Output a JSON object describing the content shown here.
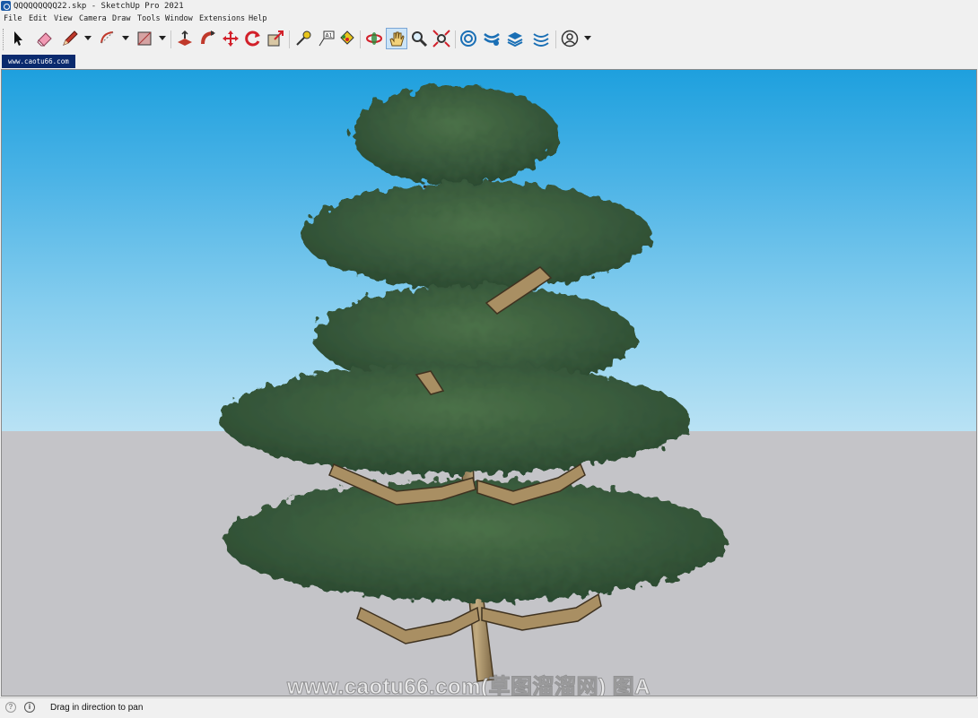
{
  "window": {
    "title": "QQQQQQQQQ22.skp - SketchUp Pro 2021"
  },
  "menu": [
    "File",
    "Edit",
    "View",
    "Camera",
    "Draw",
    "Tools",
    "Window",
    "Extensions",
    "Help"
  ],
  "toolbar": {
    "tools": [
      {
        "name": "select-tool",
        "icon": "arrow-cursor-icon"
      },
      {
        "name": "eraser-tool",
        "icon": "eraser-icon"
      },
      {
        "name": "line-tool",
        "icon": "pencil-icon"
      },
      {
        "name": "arc-tool",
        "icon": "arc-icon"
      },
      {
        "name": "rectangle-tool",
        "icon": "rectangle-icon"
      },
      {
        "name": "push-pull-tool",
        "icon": "push-pull-icon"
      },
      {
        "name": "follow-me-tool",
        "icon": "follow-me-icon"
      },
      {
        "name": "move-tool",
        "icon": "move-icon"
      },
      {
        "name": "rotate-tool",
        "icon": "rotate-icon"
      },
      {
        "name": "scale-tool",
        "icon": "scale-icon"
      },
      {
        "name": "tape-measure-tool",
        "icon": "tape-measure-icon"
      },
      {
        "name": "text-tool",
        "icon": "text-icon"
      },
      {
        "name": "paint-bucket-tool",
        "icon": "paint-bucket-icon"
      },
      {
        "name": "orbit-tool",
        "icon": "orbit-icon"
      },
      {
        "name": "pan-tool",
        "icon": "hand-icon",
        "selected": true
      },
      {
        "name": "zoom-tool",
        "icon": "zoom-icon"
      },
      {
        "name": "zoom-extents-tool",
        "icon": "zoom-extents-icon"
      },
      {
        "name": "3d-warehouse",
        "icon": "warehouse-icon"
      },
      {
        "name": "extension-warehouse",
        "icon": "extension-warehouse-icon"
      },
      {
        "name": "layout-send",
        "icon": "layers-icon"
      },
      {
        "name": "extension-manager",
        "icon": "extension-manager-icon"
      },
      {
        "name": "account",
        "icon": "user-icon"
      }
    ]
  },
  "scene_tab": {
    "label": "www.caotu66.com"
  },
  "viewport": {
    "watermark": "www.caotu66.com(草图溜溜网) 图A"
  },
  "status": {
    "text": "Drag in direction to pan"
  },
  "colors": {
    "sky_top": "#1ea0de",
    "sky_bottom": "#b9e2f4",
    "ground": "#c4c4c8",
    "foliage": "#3a5d3a",
    "wood": "#a98f63",
    "selected_tab": "#0a2a6e"
  }
}
